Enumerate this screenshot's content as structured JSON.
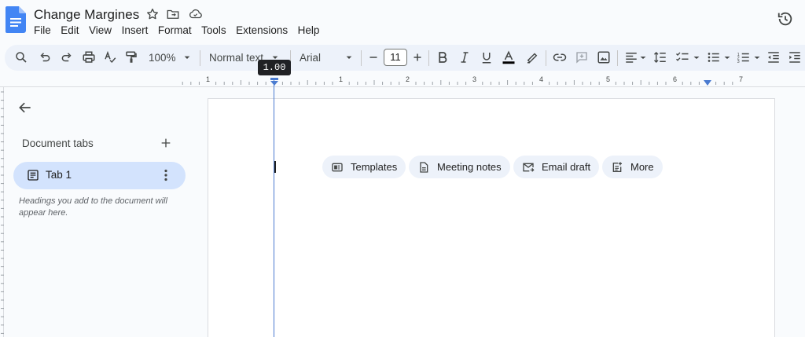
{
  "header": {
    "doc_title": "Change Margines",
    "menu": [
      "File",
      "Edit",
      "View",
      "Insert",
      "Format",
      "Tools",
      "Extensions",
      "Help"
    ]
  },
  "toolbar": {
    "zoom": "100%",
    "style": "Normal text",
    "font": "Arial",
    "font_size": "11"
  },
  "ruler": {
    "numbers": [
      "1",
      "1",
      "2",
      "3",
      "4",
      "5",
      "6",
      "7"
    ],
    "tooltip": "1.00"
  },
  "sidebar": {
    "section_label": "Document tabs",
    "tab_label": "Tab 1",
    "hint": "Headings you add to the document will appear here."
  },
  "page": {
    "chips": [
      "Templates",
      "Meeting notes",
      "Email draft",
      "More"
    ]
  },
  "colors": {
    "brand_blue": "#4285f4",
    "tab_active": "#d3e3fd",
    "toolbar_bg": "#edf2fa"
  }
}
